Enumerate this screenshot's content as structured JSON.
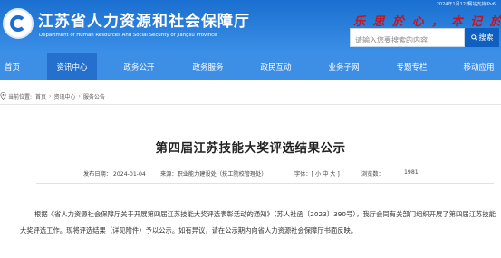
{
  "header": {
    "date": "2024年1月12日",
    "ipv6": "网站支持IPv6",
    "site_title": "江苏省人力资源和社会保障厅",
    "site_subtitle": "Department of Human Resources And Social Security of Jiangsu Province",
    "slogan": "乐 思 於 心 ， 本 记 於 行",
    "search_placeholder": "请输入您要搜索的内容",
    "search_button": "搜索"
  },
  "nav": {
    "items": [
      "首页",
      "资讯中心",
      "政务公开",
      "政务服务",
      "政民互动",
      "业务子网",
      "专题专栏",
      "移动应用"
    ],
    "active_index": 1
  },
  "breadcrumb": {
    "current_label": "当前位置:",
    "items": [
      "首页",
      "资讯中心",
      "服务公告"
    ]
  },
  "article": {
    "title": "第四届江苏技能大奖评选结果公示",
    "publish_time": "发布日期： 2024-01-04",
    "source": "来源：职业能力建设处（技工院校管理处）",
    "font_size": "字体：[ 小  中  大 ]",
    "views_label": "浏览数：",
    "views": "1981",
    "body": "根据《省人力资源社会保障厅关于开展第四届江苏技能大奖评选表彰活动的通知》（苏人社函〔2023〕390号），我厅会同有关部门组织开展了第四届江苏技能大奖评选工作。现将评选结果（详见附件）予以公示。如有异议，请在公示期内向省人力资源社会保障厅书面反映。"
  },
  "colors": {
    "header_blue": "#1a6fd0",
    "nav_blue": "#3d8ee5",
    "nav_active": "#2470cc",
    "slogan_red": "#c8131a"
  }
}
